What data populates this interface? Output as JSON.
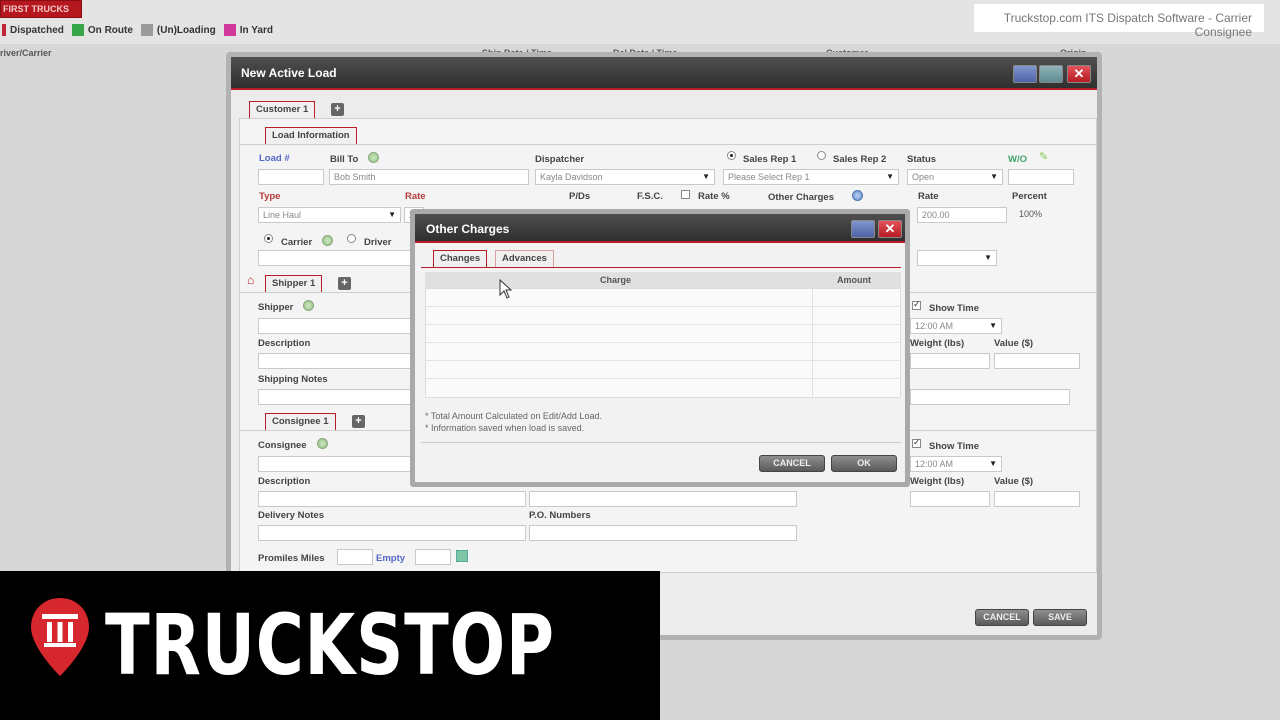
{
  "background_app": {
    "badge": "FIRST TRUCKS",
    "legend": [
      {
        "label": "Dispatched",
        "color": "#c0253a"
      },
      {
        "label": "On Route",
        "color": "#36a84a"
      },
      {
        "label": "(Un)Loading",
        "color": "#9a9a9a"
      },
      {
        "label": "In Yard",
        "color": "#d0399a"
      }
    ],
    "col_driver": "river/Carrier",
    "col_ship": "Ship Date / Time",
    "col_del": "Del Date / Time",
    "col_customer": "Customer",
    "col_origin": "Origin"
  },
  "caption": "Truckstop.com ITS Dispatch Software - Carrier Consignee",
  "main_dialog": {
    "title": "New Active Load",
    "customer_tab": "Customer 1",
    "load_info_tab": "Load Information",
    "load_no_label": "Load #",
    "bill_to_label": "Bill To",
    "bill_to_value": "Bob Smith",
    "dispatcher_label": "Dispatcher",
    "dispatcher_value": "Kayla Davidson",
    "sales_rep1": "Sales Rep 1",
    "sales_rep2": "Sales Rep 2",
    "sales_rep_select": "Please Select Rep 1",
    "status_label": "Status",
    "status_value": "Open",
    "wo_label": "W/O",
    "type_label": "Type",
    "type_value": "Line Haul",
    "rate_label": "Rate",
    "pd_label": "P/Ds",
    "fsc_label": "F.S.C.",
    "rate_pct_label": "Rate %",
    "other_charges_label": "Other Charges",
    "rate2_label": "Rate",
    "rate2_value": "200.00",
    "percent_label": "Percent",
    "percent_value": "100%",
    "carrier_label": "Carrier",
    "driver_label": "Driver",
    "rate_partial": "2(",
    "shipper_tab": "Shipper 1",
    "shipper_label": "Shipper",
    "description_label": "Description",
    "shipping_notes_label": "Shipping Notes",
    "show_time_label": "Show Time",
    "time_value": "12:00 AM",
    "weight_label": "Weight (lbs)",
    "value_label": "Value ($)",
    "consignee_tab": "Consignee 1",
    "consignee_label": "Consignee",
    "description2_label": "Description",
    "delivery_notes_label": "Delivery Notes",
    "po_numbers_label": "P.O. Numbers",
    "show_time2_label": "Show Time",
    "time2_value": "12:00 AM",
    "weight2_label": "Weight (lbs)",
    "value2_label": "Value ($)",
    "promiles_label": "Promiles Miles",
    "empty_label": "Empty",
    "cancel_label": "CANCEL",
    "save_label": "SAVE"
  },
  "modal": {
    "title": "Other Charges",
    "tabs": [
      "Changes",
      "Advances"
    ],
    "col_charge": "Charge",
    "col_amount": "Amount",
    "note1": "* Total Amount Calculated on Edit/Add Load.",
    "note2": "* Information saved when load is saved.",
    "cancel_label": "CANCEL",
    "ok_label": "OK"
  },
  "brand": {
    "logo_text": "TRUCKSTOP",
    "accent": "#d6262e"
  }
}
